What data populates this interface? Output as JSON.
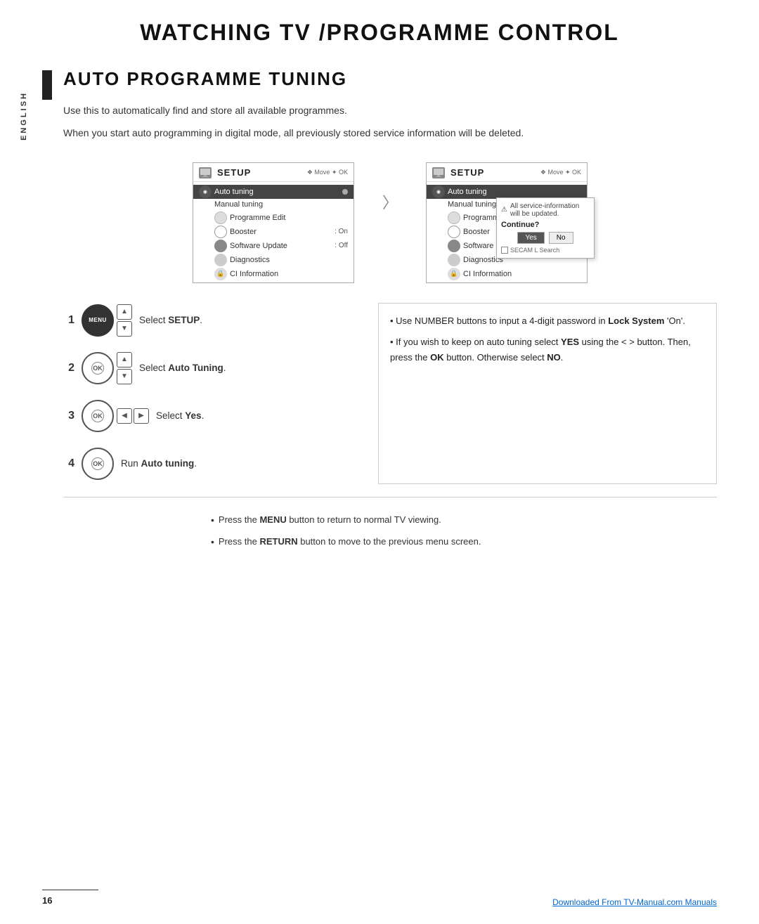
{
  "page": {
    "main_title": "WATCHING TV /PROGRAMME CONTROL",
    "section_title": "AUTO PROGRAMME TUNING",
    "sidebar_label": "ENGLISH",
    "body_text_1": "Use this to automatically find and store all available programmes.",
    "body_text_2": "When you start auto programming in digital mode, all previously stored service information will be deleted."
  },
  "screens": {
    "screen1": {
      "title": "SETUP",
      "nav": "❖ Move  ✦ OK",
      "items": [
        {
          "label": "Auto tuning",
          "highlighted": true,
          "has_dot": true
        },
        {
          "label": "Manual tuning",
          "highlighted": false
        },
        {
          "label": "Programme Edit",
          "highlighted": false
        },
        {
          "label": "Booster        : On",
          "highlighted": false
        },
        {
          "label": "Software Update : Off",
          "highlighted": false
        },
        {
          "label": "Diagnostics",
          "highlighted": false
        },
        {
          "label": "CI Information",
          "highlighted": false
        }
      ]
    },
    "screen2": {
      "title": "SETUP",
      "nav": "❖ Move  ✦ OK",
      "items": [
        {
          "label": "Auto tuning",
          "highlighted": true
        },
        {
          "label": "Manual tuning",
          "highlighted": false
        },
        {
          "label": "Programme Edit",
          "highlighted": false
        },
        {
          "label": "Booster        : On",
          "highlighted": false
        },
        {
          "label": "Software Update : Off",
          "highlighted": false
        },
        {
          "label": "Diagnostics",
          "highlighted": false
        },
        {
          "label": "CI Information",
          "highlighted": false
        }
      ],
      "dialog": {
        "warning_text": "All service-information will be updated.",
        "question": "Continue?",
        "btn_yes": "Yes",
        "btn_no": "No",
        "footer_text": "SECAM L Search"
      }
    }
  },
  "steps": [
    {
      "num": "1",
      "buttons": [
        "MENU",
        "▲",
        "▼"
      ],
      "label": "Select ",
      "label_bold": "SETUP",
      "label_suffix": "."
    },
    {
      "num": "2",
      "buttons": [
        "OK",
        "▲",
        "▼"
      ],
      "label": "Select ",
      "label_bold": "Auto Tuning",
      "label_suffix": "."
    },
    {
      "num": "3",
      "buttons": [
        "OK",
        "◀",
        "▶"
      ],
      "label": "Select ",
      "label_bold": "Yes",
      "label_suffix": "."
    },
    {
      "num": "4",
      "buttons": [
        "OK"
      ],
      "label": "Run ",
      "label_bold": "Auto tuning",
      "label_suffix": "."
    }
  ],
  "info_box": {
    "bullet1_text": "Use NUMBER buttons to input a 4-digit password in ",
    "bullet1_bold": "Lock System",
    "bullet1_suffix": " 'On'.",
    "bullet2_text": "If you wish to keep on auto tuning select ",
    "bullet2_bold": "YES",
    "bullet2_suffix": " using the  ‹ ›  button. Then, press the ",
    "bullet2_bold2": "OK",
    "bullet2_suffix2": " button. Otherwise select ",
    "bullet2_bold3": "NO",
    "bullet2_suffix3": "."
  },
  "notes": {
    "note1": "Press the ",
    "note1_bold": "MENU",
    "note1_suffix": " button to return to normal TV viewing.",
    "note2": "Press the ",
    "note2_bold": "RETURN",
    "note2_suffix": " button to move to the previous menu screen."
  },
  "footer": {
    "page_number": "16",
    "link_text": "Downloaded From TV-Manual.com Manuals"
  }
}
